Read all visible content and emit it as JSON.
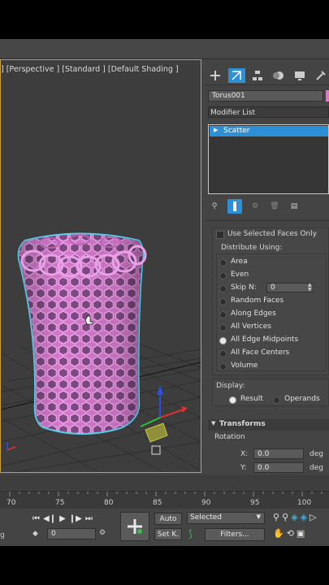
{
  "viewport": {
    "label": "[+] [Perspective ] [Standard ] [Default Shading ]",
    "label_visible": "] [Perspective ] [Standard ] [Default Shading ]"
  },
  "command_panel": {
    "tabs": [
      "create-icon",
      "modify-icon",
      "hierarchy-icon",
      "motion-icon",
      "display-icon",
      "utilities-icon"
    ],
    "object_name": "Torus001",
    "object_color": "#e86fd4",
    "modifier_list_label": "Modifier List",
    "stack_items": [
      "Scatter"
    ],
    "stack_selected": 0
  },
  "scatter": {
    "use_selected_faces_label": "Use Selected Faces Only",
    "distribute_label": "Distribute Using:",
    "options": [
      "Area",
      "Even",
      "Skip N:",
      "Random Faces",
      "Along Edges",
      "All Vertices",
      "All Edge Midpoints",
      "All Face Centers",
      "Volume"
    ],
    "selected_option": "All Edge Midpoints",
    "skip_n_value": "0",
    "display_label": "Display:",
    "display_result": "Result",
    "display_operands": "Operands"
  },
  "transforms": {
    "title": "Transforms",
    "rotation_label": "Rotation",
    "x_label": "X:",
    "x_value": "0.0",
    "y_label": "Y:",
    "y_value": "0.0",
    "unit": "deg"
  },
  "timeline": {
    "ticks": [
      "70",
      "75",
      "80",
      "85",
      "90",
      "95",
      "100"
    ]
  },
  "status_bar": {
    "frame_value": "0",
    "auto_label": "Auto",
    "setkey_label": "Set K.",
    "selected_label": "Selected",
    "filters_label": "Filters..."
  },
  "colors": {
    "accent_blue": "#2d8fd6",
    "viewport_border": "#c9a23b",
    "object_pink": "#d67ad0",
    "selection_cyan": "#5ed0f0"
  }
}
